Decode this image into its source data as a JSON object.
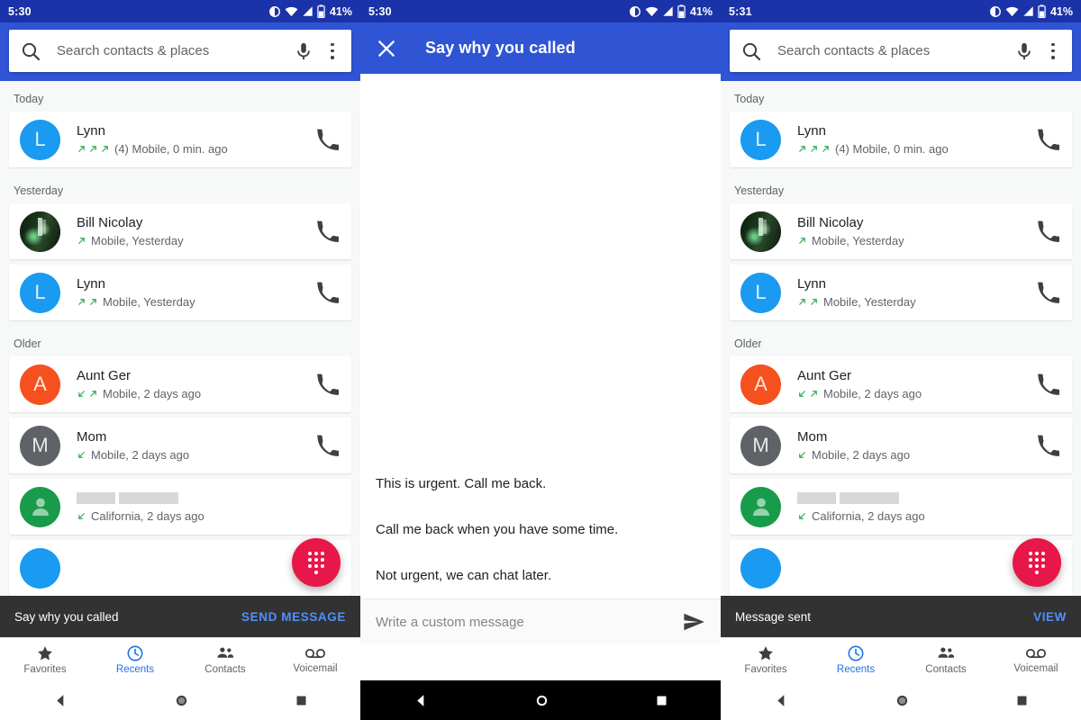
{
  "colors": {
    "status_bar": "#1a33a8",
    "app_bar": "#2f55d4",
    "accent_blue": "#1a73e8",
    "snackbar_action": "#4d90fe",
    "fab": "#e8174a",
    "call_arrow_green": "#34a853",
    "avatar_blue": "#1a9af0",
    "avatar_orange": "#f4511e",
    "avatar_gray": "#5f6368",
    "avatar_green": "#189b4a"
  },
  "panel1": {
    "status": {
      "time": "5:30",
      "battery": "41%",
      "icons": [
        "contrast-icon",
        "wifi-icon",
        "signal-icon",
        "battery-icon"
      ]
    },
    "search": {
      "placeholder": "Search contacts & places",
      "search_icon": "search-icon",
      "mic_icon": "mic-icon",
      "overflow_icon": "overflow-menu-icon"
    },
    "sections": [
      {
        "label": "Today",
        "calls": [
          {
            "name": "Lynn",
            "avatar_kind": "letter",
            "avatar_letter": "L",
            "avatar_color": "#1a9af0",
            "arrows": [
              "outgoing",
              "outgoing",
              "outgoing"
            ],
            "detail": "(4) Mobile, 0 min. ago"
          }
        ]
      },
      {
        "label": "Yesterday",
        "calls": [
          {
            "name": "Bill Nicolay",
            "avatar_kind": "photo",
            "avatar_letter": "",
            "avatar_color": "#0d1a0c",
            "arrows": [
              "outgoing"
            ],
            "detail": "Mobile, Yesterday"
          },
          {
            "name": "Lynn",
            "avatar_kind": "letter",
            "avatar_letter": "L",
            "avatar_color": "#1a9af0",
            "arrows": [
              "outgoing",
              "outgoing"
            ],
            "detail": "Mobile, Yesterday"
          }
        ]
      },
      {
        "label": "Older",
        "calls": [
          {
            "name": "Aunt Ger",
            "avatar_kind": "letter",
            "avatar_letter": "A",
            "avatar_color": "#f4511e",
            "arrows": [
              "incoming",
              "outgoing"
            ],
            "detail": "Mobile, 2 days ago"
          },
          {
            "name": "Mom",
            "avatar_kind": "letter",
            "avatar_letter": "M",
            "avatar_color": "#5f6368",
            "arrows": [
              "incoming"
            ],
            "detail": "Mobile, 2 days ago"
          },
          {
            "name": "",
            "redacted": true,
            "avatar_kind": "person",
            "avatar_letter": "",
            "avatar_color": "#189b4a",
            "arrows": [
              "incoming"
            ],
            "detail": "California, 2 days ago"
          }
        ]
      }
    ],
    "fab": {
      "icon": "dialpad-icon"
    },
    "snackbar": {
      "message": "Say why you called",
      "action": "SEND MESSAGE"
    },
    "bottomnav": [
      {
        "label": "Favorites",
        "icon": "star-icon",
        "active": false
      },
      {
        "label": "Recents",
        "icon": "clock-icon",
        "active": true
      },
      {
        "label": "Contacts",
        "icon": "people-icon",
        "active": false
      },
      {
        "label": "Voicemail",
        "icon": "voicemail-icon",
        "active": false
      }
    ],
    "sysnav": {
      "back": "back-triangle-icon",
      "home": "home-circle-icon",
      "recents": "recents-square-icon"
    }
  },
  "panel2": {
    "status": {
      "time": "5:30",
      "battery": "41%"
    },
    "appbar": {
      "title": "Say why you called",
      "close_icon": "close-icon"
    },
    "replies": [
      "This is urgent. Call me back.",
      "Call me back when you have some time.",
      "Not urgent, we can chat later."
    ],
    "custom": {
      "placeholder": "Write a custom message",
      "send_icon": "send-icon"
    },
    "sysnav": {
      "back": "back-triangle-icon",
      "home": "home-circle-icon",
      "recents": "recents-square-icon"
    }
  },
  "panel3": {
    "status": {
      "time": "5:31",
      "battery": "41%"
    },
    "search": {
      "placeholder": "Search contacts & places"
    },
    "snackbar": {
      "message": "Message sent",
      "action": "VIEW"
    }
  }
}
